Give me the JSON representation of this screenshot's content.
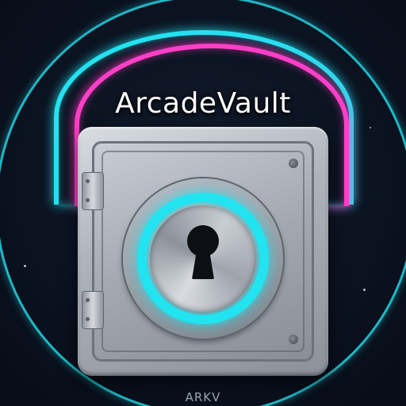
{
  "logo": {
    "title": "ArcadeVault",
    "caption": "ARKV"
  },
  "colors": {
    "neon_cyan": "#22e3f0",
    "neon_pink": "#ff3fc8",
    "background": "#0b1220",
    "steel": "#a3a9b1"
  },
  "icons": {
    "emblem": "vault-safe-icon",
    "lock": "keyhole-icon"
  }
}
